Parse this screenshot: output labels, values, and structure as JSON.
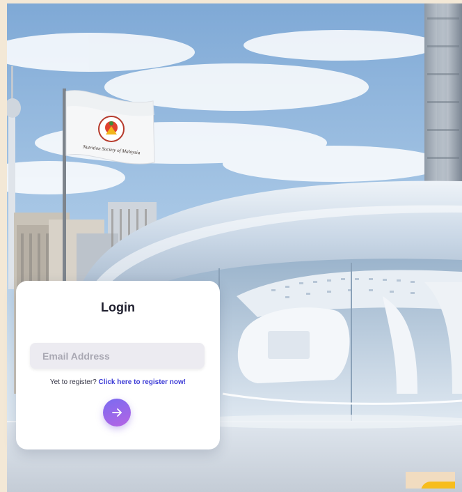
{
  "flag": {
    "logo_text": "Nutrition Society of Malaysia"
  },
  "login": {
    "title": "Login",
    "email_placeholder": "Email Address",
    "email_value": "",
    "register_prompt": "Yet to register?",
    "register_link": "Click here to register now!",
    "submit_icon": "arrow-right-icon"
  },
  "colors": {
    "accent": "#7a6bf0",
    "accent_end": "#b565e4",
    "link": "#3b3ad6",
    "sky": "#9fc3e4",
    "card": "#ffffff",
    "corner_widget": "#f7bd1c"
  }
}
